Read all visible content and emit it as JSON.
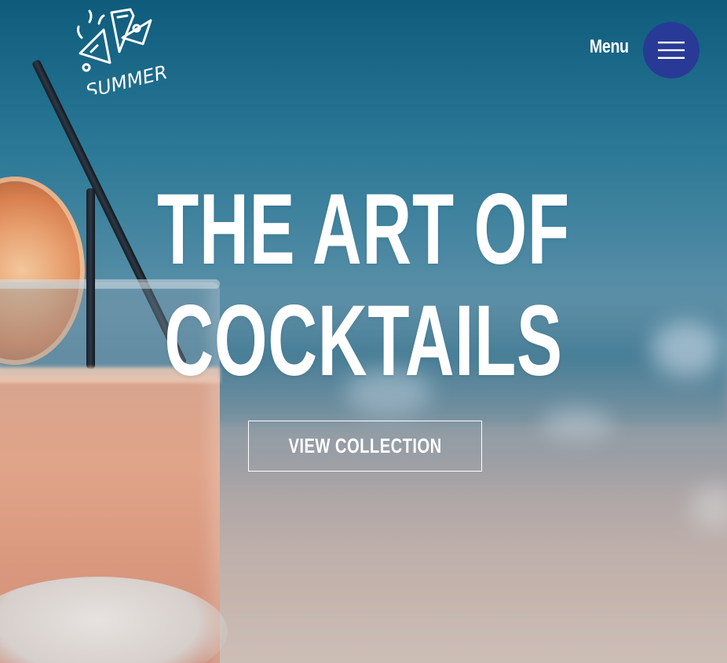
{
  "header": {
    "logo_text": "SUMMER",
    "menu_label": "Menu",
    "menu_icon": "hamburger-icon"
  },
  "hero": {
    "title_line1": "THE ART OF",
    "title_line2": "COCKTAILS",
    "cta_label": "VIEW COLLECTION"
  },
  "colors": {
    "menu_button_bg": "#283a96",
    "text": "#ffffff"
  }
}
